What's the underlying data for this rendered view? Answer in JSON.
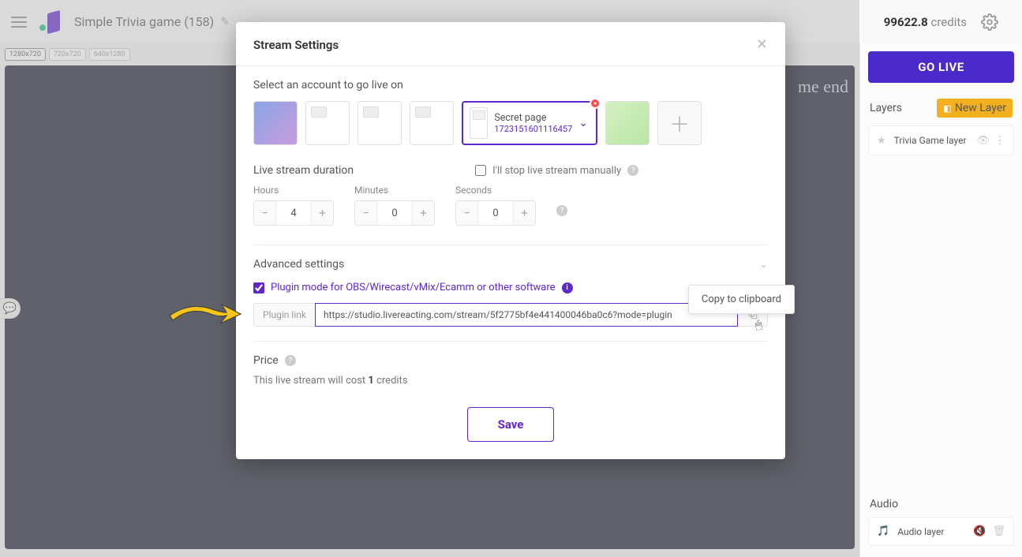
{
  "header": {
    "project_title": "Simple Trivia game (158)",
    "credits_value": "99622.8",
    "credits_label": "credits",
    "golive_label": "GO LIVE"
  },
  "resolutions": [
    "1280x720",
    "720x720",
    "640x1280"
  ],
  "stage_text": "me end",
  "sidebar": {
    "layers_title": "Layers",
    "new_layer_label": "New Layer",
    "layer_name": "Trivia Game layer",
    "audio_title": "Audio",
    "audio_layer_name": "Audio layer"
  },
  "modal": {
    "title": "Stream Settings",
    "select_account_label": "Select an account to go live on",
    "selected_account": {
      "name": "Secret page",
      "id": "1723151601116457"
    },
    "duration_label": "Live stream duration",
    "manual_stop_label": "I'll stop live stream manually",
    "hours_label": "Hours",
    "minutes_label": "Minutes",
    "seconds_label": "Seconds",
    "hours_value": "4",
    "minutes_value": "0",
    "seconds_value": "0",
    "advanced_label": "Advanced settings",
    "plugin_mode_label": "Plugin mode for OBS/Wirecast/vMix/Ecamm or other software",
    "plugin_link_label": "Plugin link",
    "plugin_link_value": "https://studio.livereacting.com/stream/5f2775bf4e441400046ba0c6?mode=plugin",
    "tooltip_copy": "Copy to clipboard",
    "price_label": "Price",
    "price_text_pre": "This live stream will cost ",
    "price_credits": "1",
    "price_text_post": " credits",
    "save_label": "Save"
  }
}
